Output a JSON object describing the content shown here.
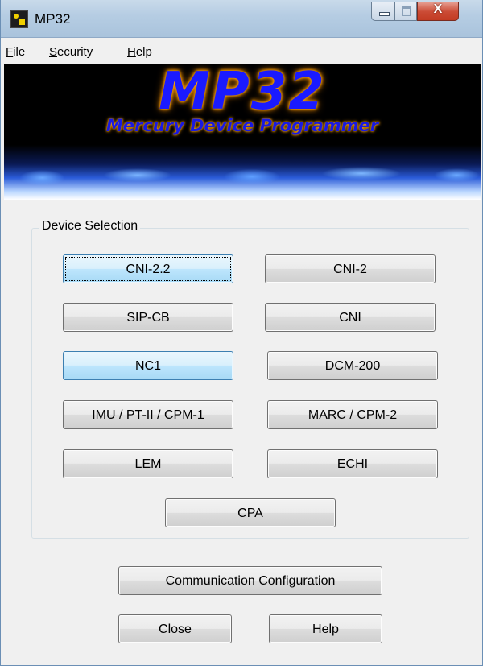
{
  "window": {
    "title": "MP32",
    "close_glyph": "X"
  },
  "menu": {
    "items": [
      {
        "accel": "F",
        "rest": "ile"
      },
      {
        "accel": "S",
        "rest": "ecurity"
      },
      {
        "accel": "H",
        "rest": "elp"
      }
    ]
  },
  "banner": {
    "title": "MP32",
    "subtitle": "Mercury Device Programmer"
  },
  "device_selection": {
    "label": "Device Selection",
    "buttons": [
      "CNI-2.2",
      "CNI-2",
      "SIP-CB",
      "CNI",
      "NC1",
      "DCM-200",
      "IMU / PT-II / CPM-1",
      "MARC / CPM-2",
      "LEM",
      "ECHI",
      "CPA"
    ]
  },
  "actions": {
    "communication_configuration": "Communication Configuration",
    "close": "Close",
    "help": "Help"
  },
  "icons": {
    "app": "mp32-app-icon",
    "minimize": "minimize-icon",
    "maximize": "maximize-icon",
    "close": "close-icon"
  },
  "colors": {
    "title_bar": "#b6cde3",
    "close_button": "#cb4b35",
    "hot_button": "#bee6fd",
    "banner_text": "#1a1aff",
    "banner_glow": "#ffb000"
  }
}
